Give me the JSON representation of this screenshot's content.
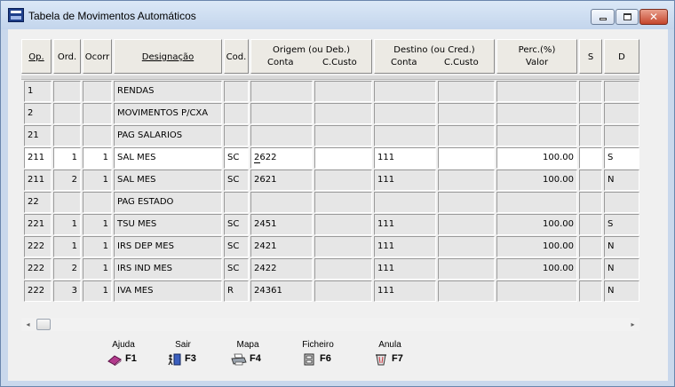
{
  "window": {
    "title": "Tabela de Movimentos Automáticos",
    "close_glyph": "✕"
  },
  "table": {
    "headers": {
      "op": "Op.",
      "ord": "Ord.",
      "ocorr": "Ocorr",
      "designacao": "Designação",
      "cod": "Cod.",
      "origem": "Origem (ou Deb.)",
      "origem_conta": "Conta",
      "origem_ccusto": "C.Custo",
      "destino": "Destino (ou Cred.)",
      "destino_conta": "Conta",
      "destino_ccusto": "C.Custo",
      "perc": "Perc.(%)",
      "valor": "Valor",
      "s": "S",
      "d": "D"
    },
    "rows": [
      {
        "op": "1",
        "ord": "",
        "ocorr": "",
        "designacao": "RENDAS",
        "cod": "",
        "origem_conta": "",
        "origem_ccusto": "",
        "destino_conta": "",
        "destino_ccusto": "",
        "valor": "",
        "s": "",
        "d": ""
      },
      {
        "op": "2",
        "ord": "",
        "ocorr": "",
        "designacao": "MOVIMENTOS P/CXA",
        "cod": "",
        "origem_conta": "",
        "origem_ccusto": "",
        "destino_conta": "",
        "destino_ccusto": "",
        "valor": "",
        "s": "",
        "d": ""
      },
      {
        "op": "21",
        "ord": "",
        "ocorr": "",
        "designacao": "PAG SALARIOS",
        "cod": "",
        "origem_conta": "",
        "origem_ccusto": "",
        "destino_conta": "",
        "destino_ccusto": "",
        "valor": "",
        "s": "",
        "d": ""
      },
      {
        "op": "211",
        "ord": "1",
        "ocorr": "1",
        "designacao": "SAL MES",
        "cod": "SC",
        "origem_conta": "2622",
        "origem_ccusto": "",
        "destino_conta": "111",
        "destino_ccusto": "",
        "valor": "100.00",
        "s": "",
        "d": "S"
      },
      {
        "op": "211",
        "ord": "2",
        "ocorr": "1",
        "designacao": "SAL MES",
        "cod": "SC",
        "origem_conta": "2621",
        "origem_ccusto": "",
        "destino_conta": "111",
        "destino_ccusto": "",
        "valor": "100.00",
        "s": "",
        "d": "N"
      },
      {
        "op": "22",
        "ord": "",
        "ocorr": "",
        "designacao": "PAG ESTADO",
        "cod": "",
        "origem_conta": "",
        "origem_ccusto": "",
        "destino_conta": "",
        "destino_ccusto": "",
        "valor": "",
        "s": "",
        "d": ""
      },
      {
        "op": "221",
        "ord": "1",
        "ocorr": "1",
        "designacao": "TSU MES",
        "cod": "SC",
        "origem_conta": "2451",
        "origem_ccusto": "",
        "destino_conta": "111",
        "destino_ccusto": "",
        "valor": "100.00",
        "s": "",
        "d": "S"
      },
      {
        "op": "222",
        "ord": "1",
        "ocorr": "1",
        "designacao": "IRS DEP MES",
        "cod": "SC",
        "origem_conta": "2421",
        "origem_ccusto": "",
        "destino_conta": "111",
        "destino_ccusto": "",
        "valor": "100.00",
        "s": "",
        "d": "N"
      },
      {
        "op": "222",
        "ord": "2",
        "ocorr": "1",
        "designacao": "IRS IND MES",
        "cod": "SC",
        "origem_conta": "2422",
        "origem_ccusto": "",
        "destino_conta": "111",
        "destino_ccusto": "",
        "valor": "100.00",
        "s": "",
        "d": "N"
      },
      {
        "op": "222",
        "ord": "3",
        "ocorr": "1",
        "designacao": "IVA MES",
        "cod": "R",
        "origem_conta": "24361",
        "origem_ccusto": "",
        "destino_conta": "111",
        "destino_ccusto": "",
        "valor": "",
        "s": "",
        "d": "N"
      }
    ]
  },
  "scrollbar": {
    "left_glyph": "◂",
    "right_glyph": "▸"
  },
  "function_keys": [
    {
      "label": "Ajuda",
      "key": "F1",
      "icon": "book-icon"
    },
    {
      "label": "Sair",
      "key": "F3",
      "icon": "exit-door-icon"
    },
    {
      "label": "Mapa",
      "key": "F4",
      "icon": "printer-icon"
    },
    {
      "label": "Ficheiro",
      "key": "F6",
      "icon": "file-cabinet-icon"
    },
    {
      "label": "Anula",
      "key": "F7",
      "icon": "trash-bin-icon"
    }
  ],
  "colors": {
    "title_bar": "#c9d8ec",
    "close_button": "#c5462c",
    "grid_cell": "#e6e6e6",
    "selected_row": "#ffffff"
  }
}
